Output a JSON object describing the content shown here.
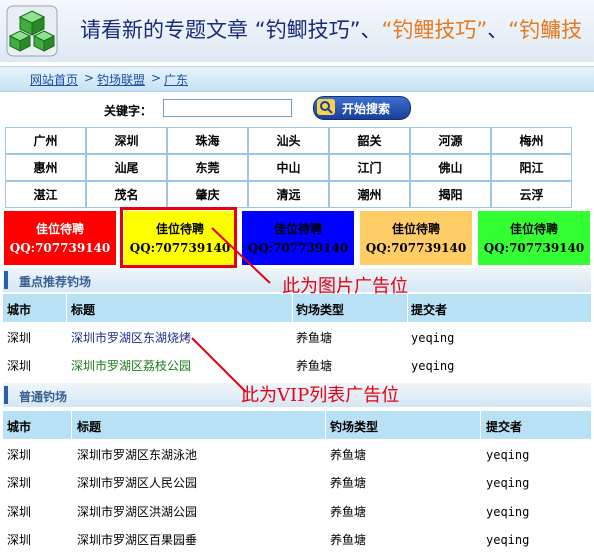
{
  "banner": {
    "prefix": "请看新的专题文章",
    "q_open": "“",
    "q_close": "”",
    "sep": "、",
    "topic1": "钓鲫技巧",
    "topic2": "钓鲤技巧",
    "topic3": "钓鳙技"
  },
  "breadcrumb": {
    "home": "网站首页",
    "sep": ">",
    "league": "钓场联盟",
    "current": "广东"
  },
  "search": {
    "label": "关键字：",
    "value": "",
    "button": "开始搜索"
  },
  "cities": [
    [
      "广州",
      "深圳",
      "珠海",
      "汕头",
      "韶关",
      "河源",
      "梅州"
    ],
    [
      "惠州",
      "汕尾",
      "东莞",
      "中山",
      "江门",
      "佛山",
      "阳江"
    ],
    [
      "湛江",
      "茂名",
      "肇庆",
      "清远",
      "潮州",
      "揭阳",
      "云浮"
    ]
  ],
  "ads": [
    {
      "line1": "佳位待聘",
      "line2": "QQ:707739140",
      "bg": "#ff0000",
      "fg": "#ffffff"
    },
    {
      "line1": "佳位待聘",
      "line2": "QQ:707739140",
      "bg": "#ffff00",
      "fg": "#000000"
    },
    {
      "line1": "佳位待聘",
      "line2": "QQ:707739140",
      "bg": "#0000ff",
      "fg": "#000000"
    },
    {
      "line1": "佳位待聘",
      "line2": "QQ:707739140",
      "bg": "#ffcc66",
      "fg": "#000000"
    },
    {
      "line1": "佳位待聘",
      "line2": "QQ:707739140",
      "bg": "#33ff33",
      "fg": "#000000"
    }
  ],
  "annotations": {
    "image_ad": "此为图片广告位",
    "vip_ad": "此为VIP列表广告位"
  },
  "featured": {
    "title": "重点推荐钓场",
    "headers": [
      "城市",
      "标题",
      "钓场类型",
      "提交者"
    ],
    "rows": [
      {
        "city": "深圳",
        "title": "深圳市罗湖区东湖烧烤",
        "type": "养鱼塘",
        "submitter": "yeqing",
        "color": "#1a2d8c"
      },
      {
        "city": "深圳",
        "title": "深圳市罗湖区荔枝公园",
        "type": "养鱼塘",
        "submitter": "yeqing",
        "color": "#1a7a1a"
      }
    ]
  },
  "normal": {
    "title": "普通钓场",
    "headers": [
      "城市",
      "标题",
      "钓场类型",
      "提交者"
    ],
    "rows": [
      {
        "city": "深圳",
        "title": "深圳市罗湖区东湖泳池",
        "type": "养鱼塘",
        "submitter": "yeqing"
      },
      {
        "city": "深圳",
        "title": "深圳市罗湖区人民公园",
        "type": "养鱼塘",
        "submitter": "yeqing"
      },
      {
        "city": "深圳",
        "title": "深圳市罗湖区洪湖公园",
        "type": "养鱼塘",
        "submitter": "yeqing"
      },
      {
        "city": "深圳",
        "title": "深圳市罗湖区百果园垂",
        "type": "养鱼塘",
        "submitter": "yeqing"
      }
    ]
  },
  "colors": {
    "header_bg": "#b8e1f6",
    "accent": "#2b5fa8",
    "annotation": "#e60012"
  },
  "icons": [
    "cubes-logo-icon",
    "magnifier-icon"
  ]
}
